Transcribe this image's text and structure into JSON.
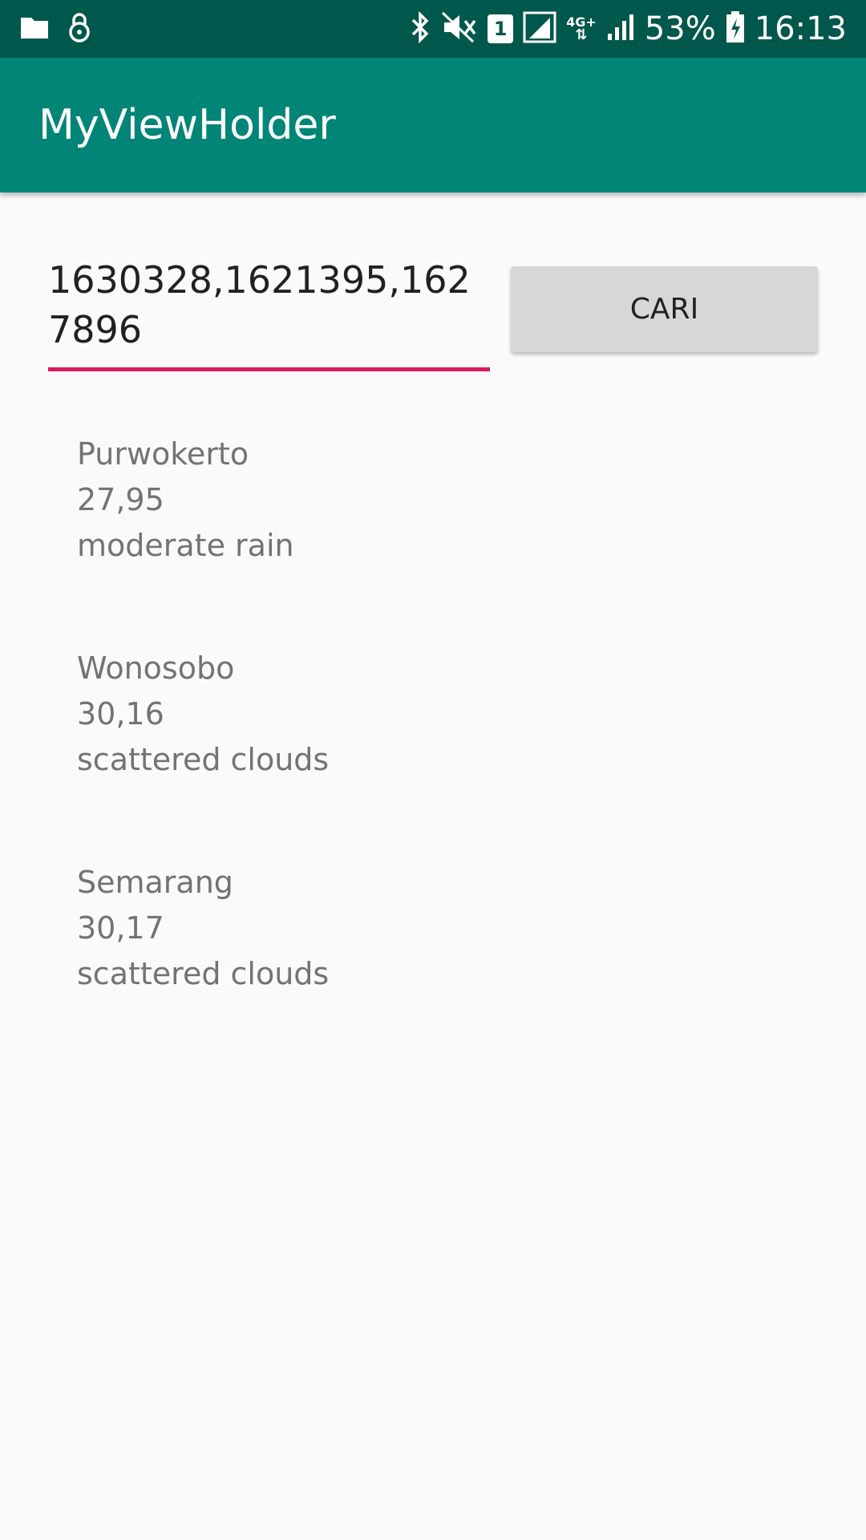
{
  "status_bar": {
    "battery": "53%",
    "time": "16:13",
    "sim_slot": "1",
    "network_type": "4G+",
    "icons": [
      "folder-icon",
      "lock-icon",
      "bluetooth-icon",
      "vibrate-icon",
      "sim-icon",
      "signal-icon",
      "network-icon",
      "signal2-icon",
      "battery-icon"
    ]
  },
  "app_bar": {
    "title": "MyViewHolder"
  },
  "search": {
    "value": "1630328,1621395,1627896"
  },
  "button": {
    "label": "CARI"
  },
  "colors": {
    "status_bar": "#00574b",
    "app_bar": "#008577",
    "accent": "#d81b60",
    "button": "#d6d7d7",
    "background": "#fafafa",
    "item_text": "#737373"
  },
  "results": [
    {
      "city": "Purwokerto",
      "temp": "27,95",
      "desc": "moderate rain"
    },
    {
      "city": "Wonosobo",
      "temp": "30,16",
      "desc": "scattered clouds"
    },
    {
      "city": "Semarang",
      "temp": "30,17",
      "desc": "scattered clouds"
    }
  ]
}
